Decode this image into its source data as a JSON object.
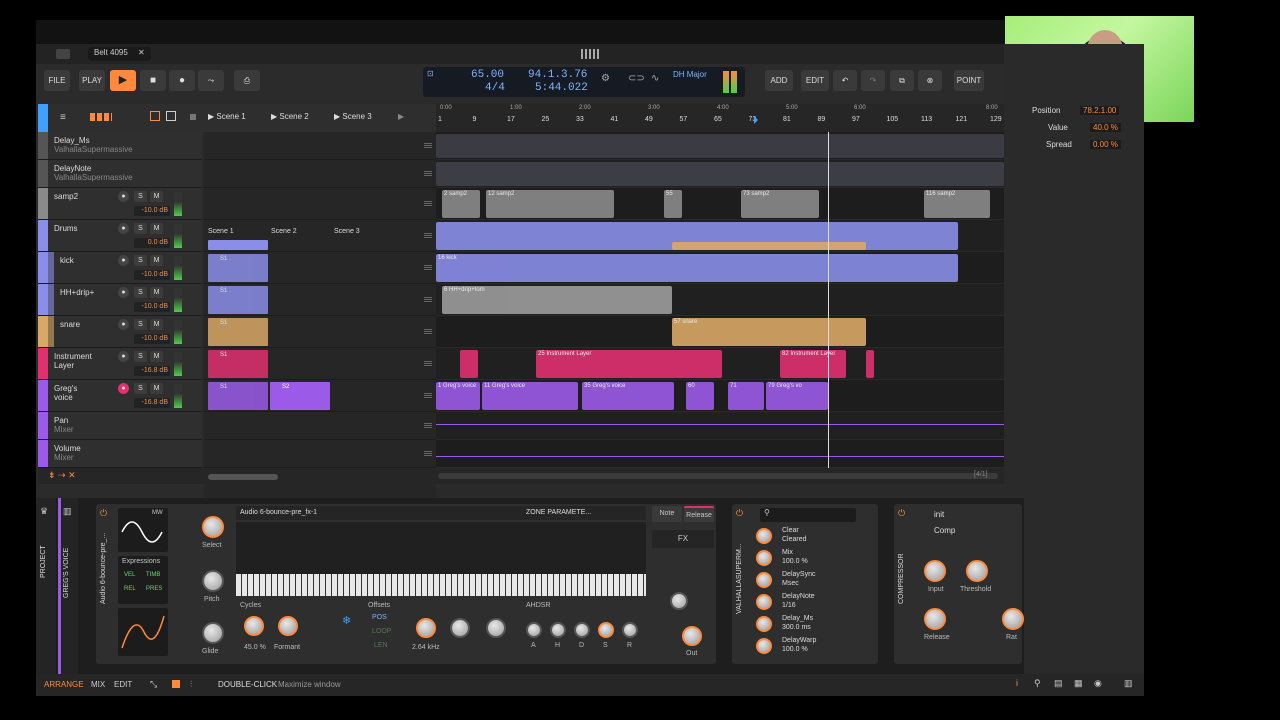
{
  "menubar": {
    "apple_icon": "apple-icon"
  },
  "project": {
    "tab_title": "Belt 4095",
    "close": "✕"
  },
  "toolbar": {
    "file": "FILE",
    "play_label": "PLAY",
    "add": "ADD",
    "edit": "EDIT",
    "point": "POINT"
  },
  "transport": {
    "tempo": "65.00",
    "signature": "4/4",
    "position": "94.1.3.76",
    "time": "5:44.022",
    "key": "DH Major"
  },
  "scenes": {
    "s1": "Scene 1",
    "s2": "Scene 2",
    "s3": "Scene 3"
  },
  "ruler": {
    "times": [
      "0:00",
      "1:00",
      "2:00",
      "3:00",
      "4:00",
      "5:00",
      "6:00",
      "8:00"
    ],
    "bars": [
      "1",
      "9",
      "17",
      "25",
      "33",
      "41",
      "49",
      "57",
      "65",
      "73",
      "81",
      "89",
      "97",
      "105",
      "113",
      "121",
      "129"
    ]
  },
  "tracks": [
    {
      "name": "Delay_Ms",
      "sub": "ValhallaSupermassive"
    },
    {
      "name": "DelayNote",
      "sub": "ValhallaSupermassive"
    },
    {
      "name": "samp2",
      "vol": "-10.0 dB"
    },
    {
      "name": "Drums",
      "vol": "0.0 dB"
    },
    {
      "name": "kick",
      "vol": "-10.0 dB"
    },
    {
      "name": "HH+drip+",
      "vol": "-10.0 dB"
    },
    {
      "name": "snare",
      "vol": "-10.0 dB"
    },
    {
      "name": "Instrument",
      "name2": "Layer",
      "vol": "-16.8 dB"
    },
    {
      "name": "Greg's",
      "name2": "voice",
      "vol": "-16.8 dB"
    },
    {
      "name": "Pan",
      "sub": "Mixer"
    },
    {
      "name": "Volume",
      "sub": "Mixer"
    }
  ],
  "clips": {
    "samp2_a": "2 samp2",
    "samp2_b": "12 samp2",
    "samp2_c": "55",
    "samp2_d": "73 samp2",
    "samp2_e": "116 samp2",
    "kick": "1",
    "kick2": "16 kick",
    "hh": "6 HH+drip+tom",
    "snare": "57 snare",
    "inst1": "25 Instrument Layer",
    "inst2": "82 Instrument Layer",
    "v1": "1 Greg's voice",
    "v2": "11 Greg's voice",
    "v3": "35 Greg's voice",
    "v4": "60",
    "v5": "71",
    "v6": "79 Greg's vo",
    "s1": "S1",
    "s2": "S2"
  },
  "page_indicator": "[4/1]",
  "inspector": {
    "pos_label": "Position",
    "pos_val": "78.2.1.00",
    "val_label": "Value",
    "val_val": "40.0 %",
    "spread_label": "Spread",
    "spread_val": "0.00 %"
  },
  "devices": {
    "left_labels": [
      "PROJECT",
      "GREG'S VOICE"
    ],
    "sampler_name": "Audio 6-bounce-pre_fx-1",
    "vert_name": "Audio 6-bounce-pre_...",
    "mw": "MW",
    "zone": "ZONE PARAMETE...",
    "expressions": "Expressions",
    "vel": "VEL",
    "timb": "TIMB",
    "rel": "REL",
    "pres": "PRES",
    "select": "Select",
    "pitch": "Pitch",
    "glide": "Glide",
    "cycles": "Cycles",
    "cycles_val": "45.0 %",
    "formant": "Formant",
    "offsets": "Offsets",
    "pos": "POS",
    "loop": "LOOP",
    "len": "LEN",
    "freq": "2.64 kHz",
    "ahdsr": "AHDSR",
    "env": [
      "A",
      "H",
      "D",
      "S",
      "R"
    ],
    "note": "Note",
    "release": "Release",
    "fx": "FX",
    "out": "Out",
    "vs_name": "VALHALLASUPERM...",
    "params": [
      {
        "name": "Clear",
        "val": "Cleared"
      },
      {
        "name": "Mix",
        "val": "100.0 %"
      },
      {
        "name": "DelaySync",
        "val": "Msec"
      },
      {
        "name": "DelayNote",
        "val": "1/16"
      },
      {
        "name": "Delay_Ms",
        "val": "300.0 ms"
      },
      {
        "name": "DelayWarp",
        "val": "100.0 %"
      }
    ],
    "comp_name": "COMPRESSOR",
    "comp_preset": "init",
    "comp": "Comp",
    "input": "Input",
    "threshold": "Threshold",
    "release_k": "Release",
    "rat": "Rat"
  },
  "status": {
    "arrange": "ARRANGE",
    "mix": "MIX",
    "edit": "EDIT",
    "dbl": "DOUBLE-CLICK",
    "hint": "Maximize window"
  },
  "colors": {
    "orange": "#ff8a3d",
    "purple": "#9b5be8",
    "lavender": "#8a8ee8",
    "tan": "#d9a866",
    "pink": "#e0306f",
    "grey": "#8a8a8a"
  }
}
